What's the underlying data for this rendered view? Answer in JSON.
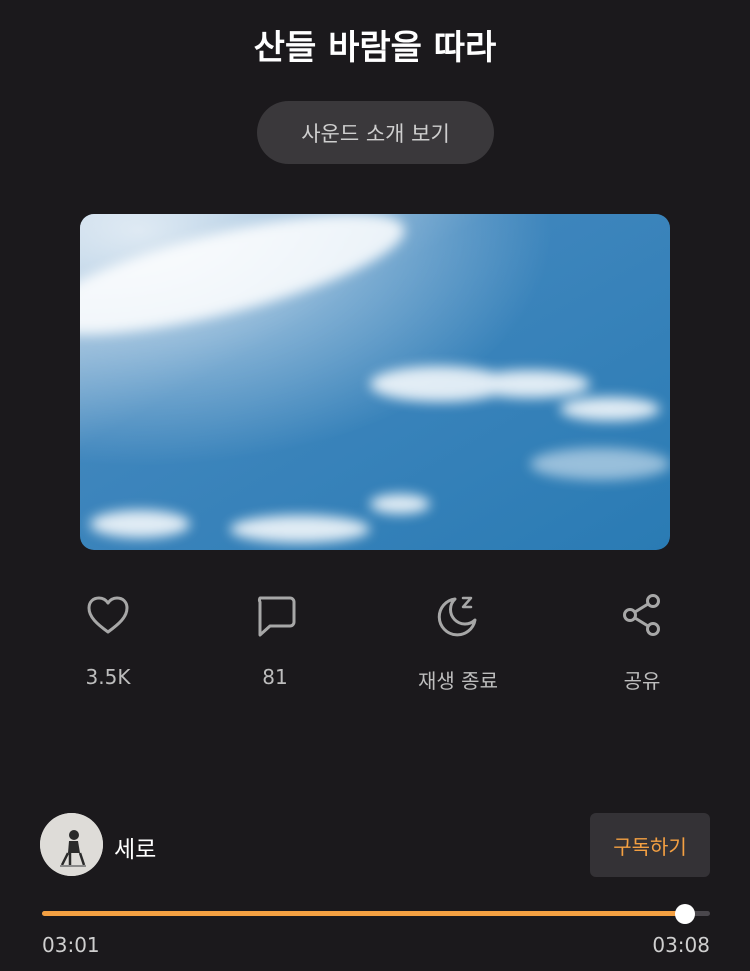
{
  "title": "산들 바람을 따라",
  "intro_button": "사운드 소개 보기",
  "actions": [
    {
      "icon": "heart-icon",
      "label": "3.5K"
    },
    {
      "icon": "comment-icon",
      "label": "81"
    },
    {
      "icon": "sleep-timer-icon",
      "label": "재생 종료"
    },
    {
      "icon": "share-icon",
      "label": "공유"
    }
  ],
  "artist": {
    "name": "세로",
    "subscribe_label": "구독하기"
  },
  "player": {
    "elapsed": "03:01",
    "total": "03:08",
    "progress": 0.962
  },
  "colors": {
    "background": "#1b191c",
    "accent": "#f4a042"
  }
}
